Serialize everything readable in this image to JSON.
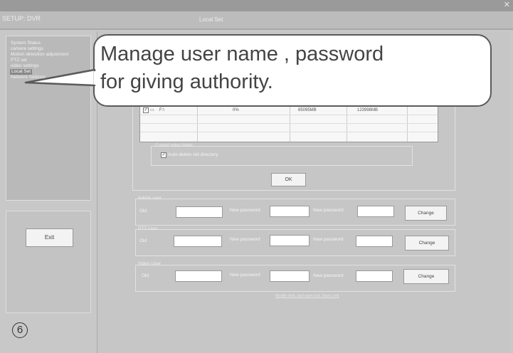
{
  "header": {
    "setup": "SETUP:  DVR",
    "title": "Local Set"
  },
  "sidebar": {
    "items": [
      {
        "label": "System Status"
      },
      {
        "label": "camera settings"
      },
      {
        "label": "Motion detection adjustment"
      },
      {
        "label": "PTZ set"
      },
      {
        "label": "video settings"
      },
      {
        "label": "Local Set"
      },
      {
        "label": "Network Settings"
      }
    ],
    "selected_index": 5,
    "exit_label": "Exit"
  },
  "callout": {
    "line1": "Manage user name , password",
    "line2": "for giving authority."
  },
  "storage": {
    "row": {
      "drive": "F:\\",
      "col2": "0%",
      "col3": "85095MB",
      "col4": "123998MB"
    },
    "current_folder_label": "Current video folder",
    "auto_delete_label": "Auto-delete old directory",
    "ok_label": "OK"
  },
  "users": {
    "admin": {
      "title": "Admin user",
      "old_label": "Old",
      "new_label": "New password",
      "new2_label": "New password",
      "change_label": "Change"
    },
    "ptz": {
      "title": "PTZ User",
      "old_label": "Old",
      "new_label": "New password",
      "new2_label": "New password",
      "change_label": "Change"
    },
    "video": {
      "title": "Video User",
      "old_label": "Old",
      "new_label": "New password",
      "new2_label": "New password",
      "change_label": "Change"
    }
  },
  "footer_link": "Modify disk, and save Ext. Save Link",
  "step_number": "6"
}
